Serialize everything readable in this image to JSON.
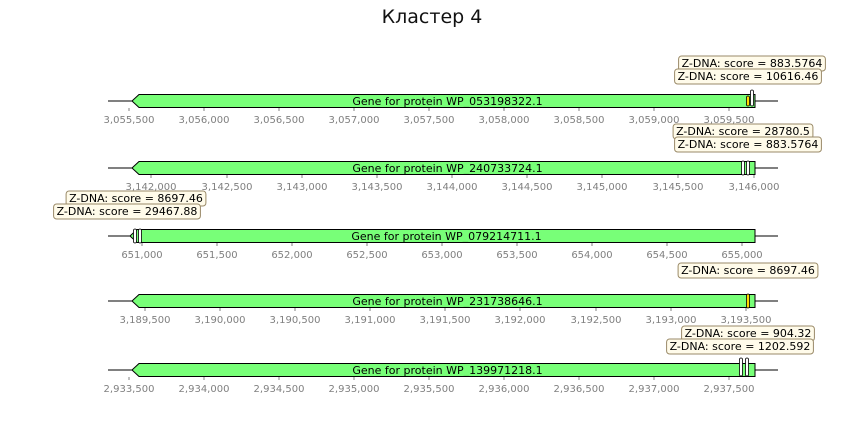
{
  "figure": {
    "title": "Кластер 4",
    "colors": {
      "gene_fill": "#78ff78",
      "annotation_fill": "#ffd700",
      "label_box_fill": "#fffbea",
      "label_box_stroke": "#9a8a68",
      "tick_color": "#808080"
    }
  },
  "tracks": [
    {
      "ticks": [
        "3,055,500",
        "3,056,000",
        "3,056,500",
        "3,057,000",
        "3,057,500",
        "3,058,000",
        "3,058,500",
        "3,059,000",
        "3,059,500"
      ],
      "gene_label": "Gene for protein WP_053198322.1",
      "annotations": [
        "Z-DNA: score = 883.5764",
        "Z-DNA: score = 10616.46"
      ]
    },
    {
      "ticks": [
        "3,142,000",
        "3,142,500",
        "3,143,000",
        "3,143,500",
        "3,144,000",
        "3,144,500",
        "3,145,000",
        "3,145,500",
        "3,146,000"
      ],
      "gene_label": "Gene for protein WP_240733724.1",
      "annotations": [
        "Z-DNA: score = 28780.5",
        "Z-DNA: score = 883.5764"
      ]
    },
    {
      "ticks": [
        "651,000",
        "651,500",
        "652,000",
        "652,500",
        "653,000",
        "653,500",
        "654,000",
        "654,500",
        "655,000"
      ],
      "gene_label": "Gene for protein WP_079214711.1",
      "annotations": [
        "Z-DNA: score = 8697.46",
        "Z-DNA: score = 29467.88"
      ]
    },
    {
      "ticks": [
        "3,189,500",
        "3,190,000",
        "3,190,500",
        "3,191,000",
        "3,191,500",
        "3,192,000",
        "3,192,500",
        "3,193,000",
        "3,193,500"
      ],
      "gene_label": "Gene for protein WP_231738646.1",
      "annotations": [
        "Z-DNA: score = 8697.46"
      ]
    },
    {
      "ticks": [
        "2,933,500",
        "2,934,000",
        "2,934,500",
        "2,935,000",
        "2,935,500",
        "2,936,000",
        "2,936,500",
        "2,937,000",
        "2,937,500"
      ],
      "gene_label": "Gene for protein WP_139971218.1",
      "annotations": [
        "Z-DNA: score = 904.32",
        "Z-DNA: score = 1202.592"
      ]
    }
  ]
}
